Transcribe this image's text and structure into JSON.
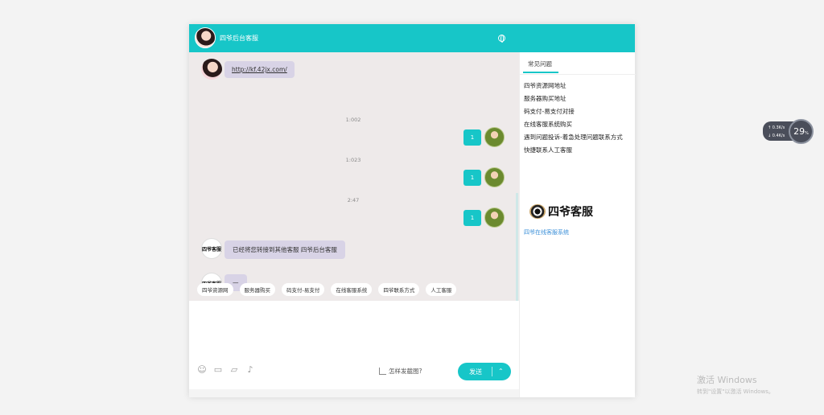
{
  "header": {
    "title": "四爷后台客服"
  },
  "messages": {
    "agent_link": "http://kf.42jx.com/",
    "times": [
      "1:002",
      "1:023",
      "2:47"
    ],
    "user_msgs": [
      "1",
      "1",
      "1"
    ],
    "agent_transfer": "已经将您转接到其他客服 四爷后台客服",
    "agent_dash": "—",
    "avatar_logo_text": "四爷客服"
  },
  "quick_tags": [
    "四爷资源网",
    "服务器购买",
    "码支付-易支付",
    "在线客服系统",
    "四爷联系方式",
    "人工客服"
  ],
  "input": {
    "screenshot_hint": "怎样发截图?",
    "send_label": "发送"
  },
  "side": {
    "tab": "常见问题",
    "faq": [
      "四爷资源网地址",
      "服务器购买地址",
      "码支付-易支付对接",
      "在线客服系统购买",
      "遇到问题投诉-着急处理问题联系方式",
      "快捷联系人工客服"
    ],
    "brand_text": "四爷客服",
    "brand_link": "四爷在线客服系统"
  },
  "speed": {
    "up": "0.3",
    "down": "0.4",
    "unit": "K/s",
    "percent": "29",
    "percent_sign": "%"
  },
  "watermark": {
    "line1": "激活 Windows",
    "line2": "转到\"设置\"以激活 Windows。"
  },
  "colors": {
    "accent": "#17c6c8",
    "bubble_left": "#d8d3e6",
    "chat_bg": "#eeeaea"
  }
}
